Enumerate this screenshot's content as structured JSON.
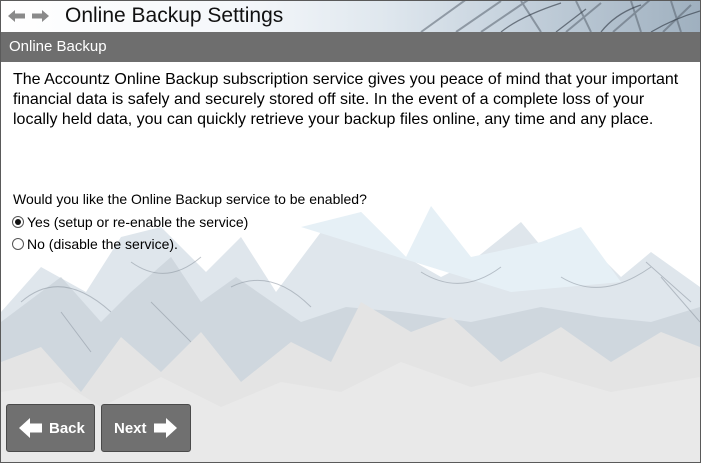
{
  "window": {
    "title": "Online Backup Settings"
  },
  "section": {
    "header": "Online Backup"
  },
  "content": {
    "description": "The Accountz Online Backup subscription service gives you peace of mind that your important financial data is safely and securely stored off site. In the event of a complete loss of your locally held data, you can quickly retrieve your backup files online, any time and any place.",
    "question": "Would you like the Online Backup service to be enabled?",
    "options": [
      {
        "label": "Yes (setup or re-enable the service)",
        "selected": true
      },
      {
        "label": "No (disable the service).",
        "selected": false
      }
    ]
  },
  "buttons": {
    "back": "Back",
    "next": "Next"
  },
  "icons": {
    "nav_back": "arrow-left-icon",
    "nav_forward": "arrow-right-icon",
    "back_button": "arrow-left-icon",
    "next_button": "arrow-right-icon"
  },
  "colors": {
    "section_header_bg": "#6e6e6e",
    "button_bg": "#707070",
    "nav_arrow": "#8a8a8a"
  }
}
